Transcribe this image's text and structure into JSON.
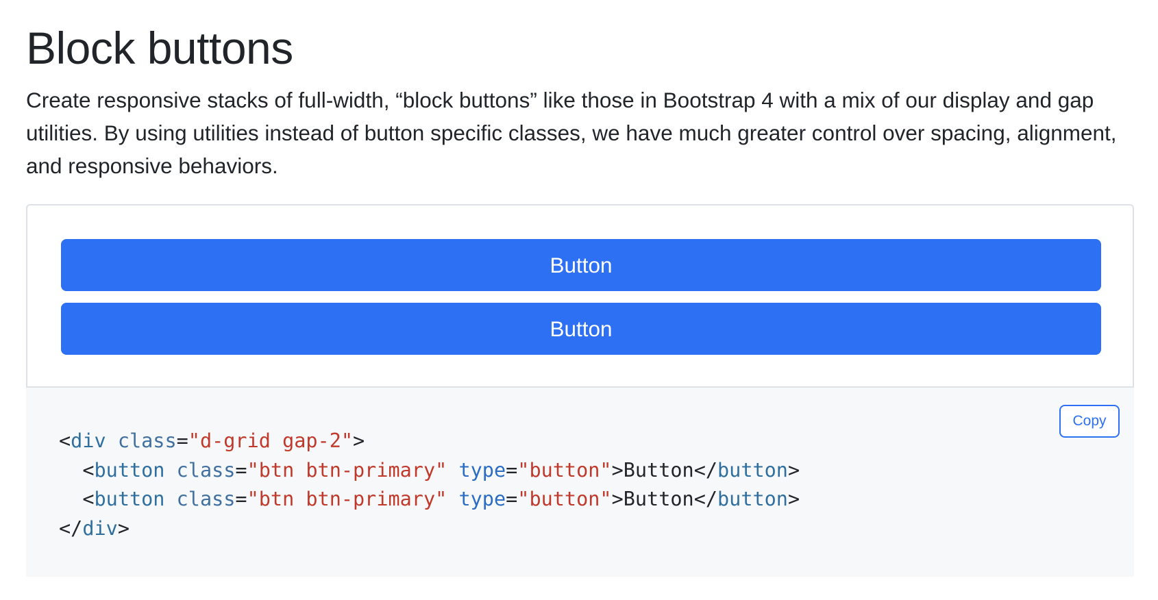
{
  "page": {
    "title": "Block buttons",
    "description": "Create responsive stacks of full-width, “block buttons” like those in Bootstrap 4 with a mix of our display and gap utilities. By using utilities instead of button specific classes, we have much greater control over spacing, alignment, and responsive behaviors."
  },
  "example": {
    "buttons": [
      {
        "label": "Button"
      },
      {
        "label": "Button"
      }
    ]
  },
  "code_block": {
    "copy_label": "Copy",
    "lines": [
      {
        "open": "<",
        "tag": "div",
        "attr1": "class",
        "eq1": "=",
        "val1": "\"d-grid gap-2\"",
        "close": ">"
      },
      {
        "indent": "  ",
        "open": "<",
        "tag": "button",
        "attr1": "class",
        "eq1": "=",
        "val1": "\"btn btn-primary\"",
        "attr2": "type",
        "eq2": "=",
        "val2": "\"button\"",
        "close": ">",
        "text": "Button",
        "end_open": "</",
        "end_tag": "button",
        "end_close": ">"
      },
      {
        "indent": "  ",
        "open": "<",
        "tag": "button",
        "attr1": "class",
        "eq1": "=",
        "val1": "\"btn btn-primary\"",
        "attr2": "type",
        "eq2": "=",
        "val2": "\"button\"",
        "close": ">",
        "text": "Button",
        "end_open": "</",
        "end_tag": "button",
        "end_close": ">"
      },
      {
        "end_open": "</",
        "end_tag": "div",
        "end_close": ">"
      }
    ]
  },
  "colors": {
    "primary": "#2d70f3",
    "text": "#212529",
    "code_bg": "#f7f8fa",
    "string": "#c0392b",
    "tag_name": "#2f6f9f",
    "attribute": "#4070a0"
  }
}
